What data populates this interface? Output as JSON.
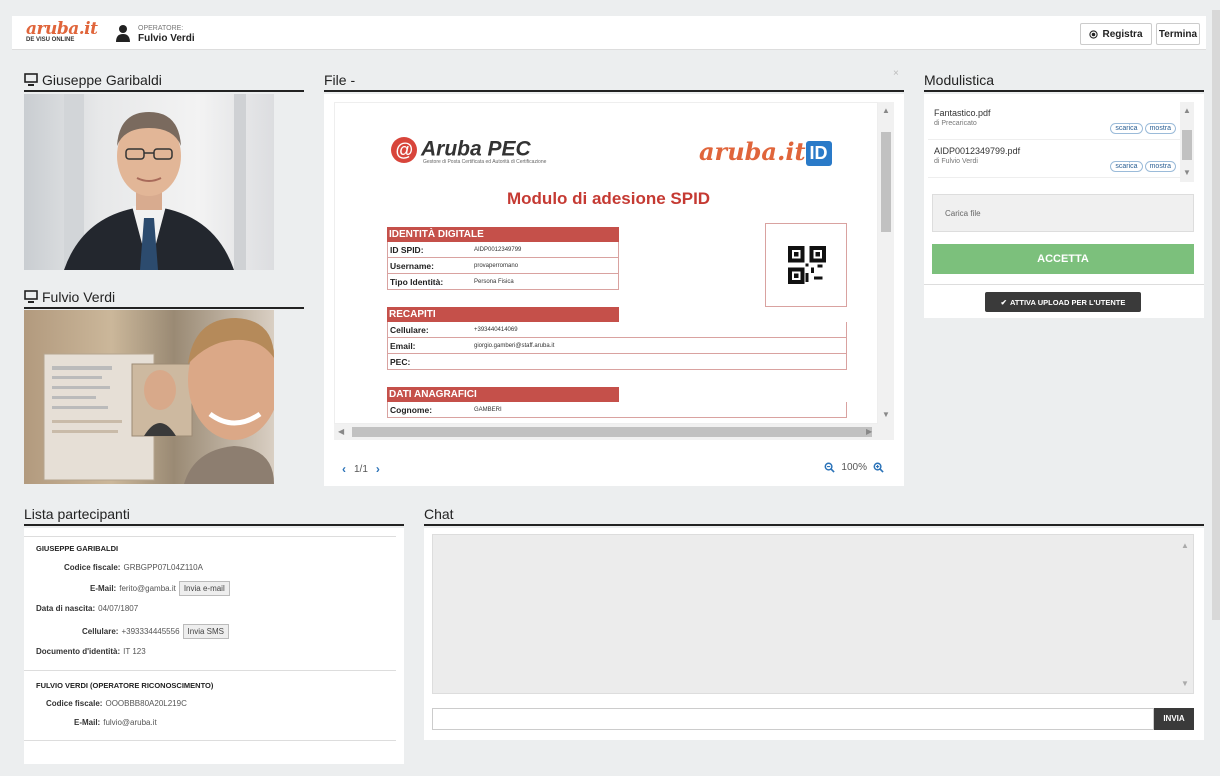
{
  "header": {
    "logo_text": "aruba.it",
    "logo_sub": "DE VISU ONLINE",
    "operator_label": "OPERATORE:",
    "operator_name": "Fulvio Verdi",
    "registra_label": "Registra",
    "termina_label": "Termina"
  },
  "videos": {
    "participant_name": "Giuseppe Garibaldi",
    "operator_name": "Fulvio Verdi"
  },
  "file": {
    "title": "File -",
    "close": "×",
    "page_indicator": "1/1",
    "zoom": "100%",
    "doc": {
      "brand_left": "Aruba PEC",
      "brand_left_tag": "Gestore di Posta Certificata ed Autorità di Certificazione",
      "brand_right": "aruba.it",
      "brand_right_badge": "ID",
      "title": "Modulo di adesione SPID",
      "sections": [
        {
          "header": "IDENTITÀ DIGITALE",
          "rows": [
            {
              "k": "ID SPID:",
              "v": "AIDP0012349799"
            },
            {
              "k": "Username:",
              "v": "provaperromano"
            },
            {
              "k": "Tipo Identità:",
              "v": "Persona Fisica"
            }
          ]
        },
        {
          "header": "RECAPITI",
          "rows": [
            {
              "k": "Cellulare:",
              "v": "+393440414069"
            },
            {
              "k": "Email:",
              "v": "giorgio.gamberi@staff.aruba.it"
            },
            {
              "k": "PEC:",
              "v": ""
            }
          ]
        },
        {
          "header": "DATI ANAGRAFICI",
          "rows": [
            {
              "k": "Cognome:",
              "v": "GAMBERI"
            }
          ]
        }
      ]
    }
  },
  "modulistica": {
    "title": "Modulistica",
    "items": [
      {
        "name": "Fantastico.pdf",
        "by": "di Precaricato",
        "scarica": "scarica",
        "mostra": "mostra"
      },
      {
        "name": "AIDP0012349799.pdf",
        "by": "di Fulvio Verdi",
        "scarica": "scarica",
        "mostra": "mostra"
      }
    ],
    "carica_label": "Carica file",
    "accetta_label": "ACCETTA",
    "attiva_label": "ATTIVA UPLOAD PER L'UTENTE"
  },
  "partecipanti": {
    "title": "Lista partecipanti",
    "p1": {
      "name": "GIUSEPPE GARIBALDI",
      "cf_label": "Codice fiscale:",
      "cf": "GRBGPP07L04Z110A",
      "email_label": "E-Mail:",
      "email": "ferito@gamba.it",
      "email_btn": "Invia e-mail",
      "dob_label": "Data di nascita:",
      "dob": "04/07/1807",
      "cell_label": "Cellulare:",
      "cell": "+393334445556",
      "sms_btn": "Invia SMS",
      "doc_label": "Documento d'identità:",
      "doc": "IT 123"
    },
    "p2": {
      "name": "FULVIO VERDI (OPERATORE RICONOSCIMENTO)",
      "cf_label": "Codice fiscale:",
      "cf": "OOOBBB80A20L219C",
      "email_label": "E-Mail:",
      "email": "fulvio@aruba.it"
    }
  },
  "chat": {
    "title": "Chat",
    "send_label": "INVIA",
    "input_placeholder": ""
  },
  "colors": {
    "brand_orange": "#e0653b",
    "accent_green": "#7cc07c",
    "doc_red": "#c5504a",
    "link_blue": "#2a72b8"
  }
}
